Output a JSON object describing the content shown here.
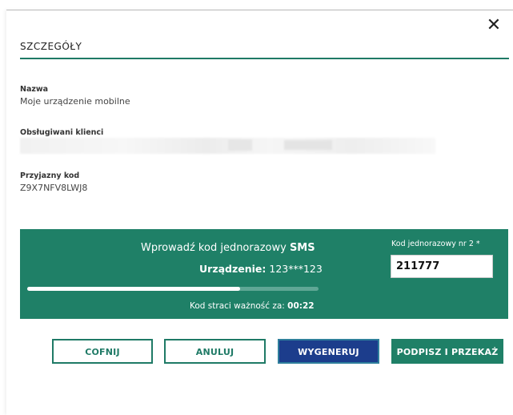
{
  "dialog": {
    "title": "SZCZEGÓŁY",
    "close_symbol": "✕"
  },
  "details": {
    "name_label": "Nazwa",
    "name_value": "Moje urządzenie mobilne",
    "clients_label": "Obsługiwani klienci",
    "friendly_code_label": "Przyjazny kod",
    "friendly_code_value": "Z9X7NFV8LWJ8"
  },
  "sms": {
    "prompt_text": "Wprowadź kod jednorazowy ",
    "prompt_highlight": "SMS",
    "device_label": "Urządzenie:",
    "device_value": " 123***123",
    "progress_fraction": 0.73,
    "expiry_label": "Kod straci ważność za: ",
    "expiry_value": "00:22",
    "code_label": "Kod jednorazowy nr 2 *",
    "code_value": "211777"
  },
  "buttons": {
    "back": "COFNIJ",
    "cancel": "ANULUJ",
    "generate": "WYGENERUJ",
    "sign_send": "PODPISZ I PRZEKAŻ"
  },
  "colors": {
    "accent_green": "#1f8067",
    "button_blue": "#1c3d8c"
  }
}
